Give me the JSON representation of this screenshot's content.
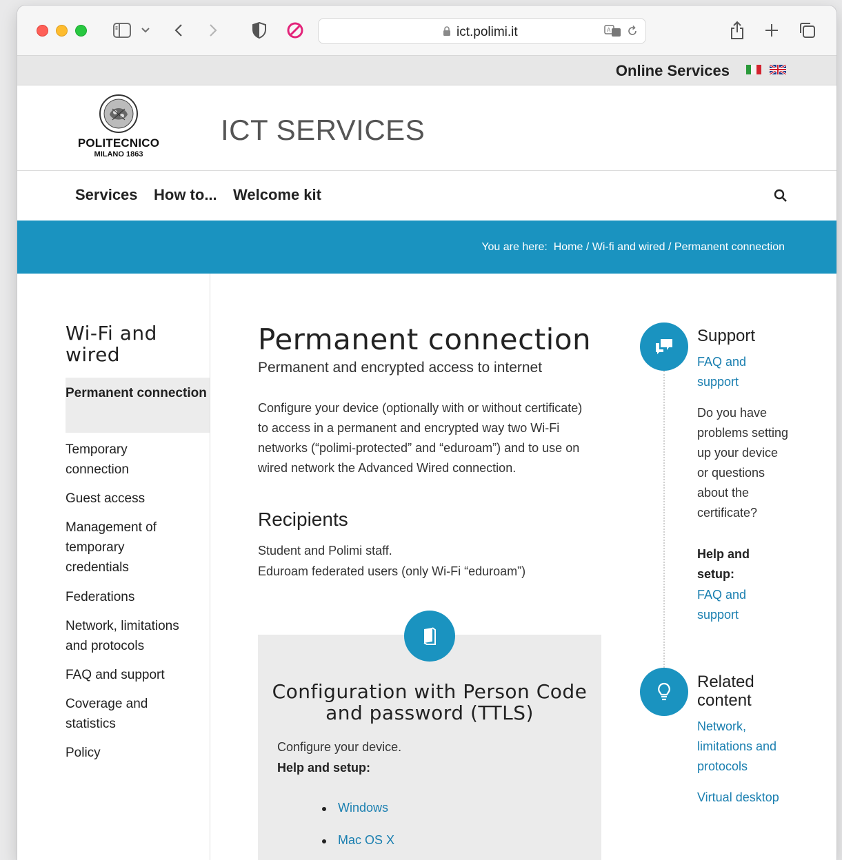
{
  "browser": {
    "url": "ict.polimi.it",
    "icons": [
      "sidebar-icon",
      "chevron-down-icon",
      "back-icon",
      "forward-icon",
      "shield-icon",
      "block-icon",
      "lock-icon",
      "translate-icon",
      "reload-icon",
      "share-icon",
      "new-tab-icon",
      "tabs-overview-icon"
    ]
  },
  "topbar": {
    "online_services": "Online Services"
  },
  "header": {
    "logo_name": "POLITECNICO",
    "logo_sub": "MILANO 1863",
    "site_title": "ICT SERVICES"
  },
  "nav": {
    "items": [
      "Services",
      "How to...",
      "Welcome kit"
    ]
  },
  "breadcrumb": {
    "prefix": "You are here:",
    "items": [
      "Home",
      "Wi-fi and wired",
      "Permanent connection"
    ]
  },
  "sidebar": {
    "title": "Wi-Fi and wired",
    "items": [
      "Permanent connection",
      "Temporary connection",
      "Guest access",
      "Management of temporary credentials",
      "Federations",
      "Network, limitations and protocols",
      "FAQ and support",
      "Coverage and statistics",
      "Policy"
    ]
  },
  "main": {
    "title": "Permanent connection",
    "subtitle": "Permanent and encrypted access to internet",
    "body": "Configure your device (optionally with or without certificate) to access in a permanent and encrypted way two Wi-Fi networks (“polimi-protected” and “eduroam”) and to use on wired network the Advanced Wired connection.",
    "recipients_title": "Recipients",
    "recipients": [
      "Student and Polimi staff.",
      "Eduroam federated users (only Wi-Fi “eduroam”)"
    ],
    "card": {
      "title": "Configuration with Person Code and password (TTLS)",
      "text": "Configure your device.",
      "help": "Help and setup:",
      "links": [
        "Windows",
        "Mac OS X"
      ]
    }
  },
  "right": {
    "support_title": "Support",
    "support_link": "FAQ and support",
    "support_text": "Do you have problems setting up your device or questions about the certificate?",
    "help_label": "Help and setup:",
    "help_link": "FAQ and support",
    "related_title": "Related content",
    "related_links": [
      "Network, limitations and protocols",
      "Virtual desktop"
    ]
  },
  "colors": {
    "accent": "#1a93c0",
    "link": "#1a7fb0"
  }
}
